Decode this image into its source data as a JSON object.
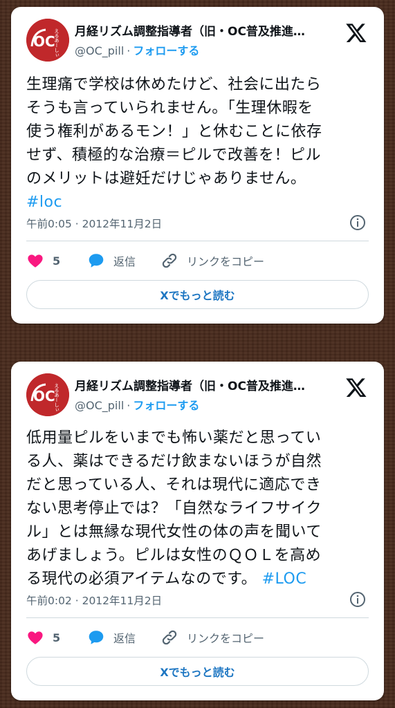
{
  "tweets": [
    {
      "author_name": "月経リズム調整指導者（旧・OC普及推進…",
      "handle": "@OC_pill",
      "separator": "·",
      "follow_label": "フォローする",
      "avatar_text": "OC",
      "avatar_side_text": "えるあーしぃ",
      "body_lines": [
        "生理痛で学校は休めたけど、社会に出たら",
        "そうも言っていられません。「生理休暇を",
        "使う権利があるモン！」と休むことに依存",
        "せず、積極的な治療＝ピルで改善を！ピル",
        "のメリットは避妊だけじゃありません。"
      ],
      "hashtag": "#loc",
      "timestamp": "午前0:05 · 2012年11月2日",
      "like_count": "5",
      "reply_label": "返信",
      "copy_link_label": "リンクをコピー",
      "more_label": "Xでもっと読む"
    },
    {
      "author_name": "月経リズム調整指導者（旧・OC普及推進…",
      "handle": "@OC_pill",
      "separator": "·",
      "follow_label": "フォローする",
      "avatar_text": "OC",
      "avatar_side_text": "えるあーしぃ",
      "body_lines": [
        "低用量ピルをいまでも怖い薬だと思ってい",
        "る人、薬はできるだけ飲まないほうが自然",
        "だと思っている人、それは現代に適応でき",
        "ない思考停止では？「自然なライフサイク",
        "ル」とは無縁な現代女性の体の声を聞いて",
        "あげましょう。ピルは女性のＱＯＬを高め",
        "る現代の必須アイテムなのです。 "
      ],
      "hashtag": "#LOC",
      "timestamp": "午前0:02 · 2012年11月2日",
      "like_count": "5",
      "reply_label": "返信",
      "copy_link_label": "リンクをコピー",
      "more_label": "Xでもっと読む"
    }
  ],
  "colors": {
    "accent": "#1d9bf0",
    "like": "#f91880",
    "avatar_bg": "#c0282b",
    "background": "#4a2c1e"
  },
  "icons": [
    "x-logo-icon",
    "info-icon",
    "heart-icon",
    "reply-bubble-icon",
    "link-icon"
  ]
}
